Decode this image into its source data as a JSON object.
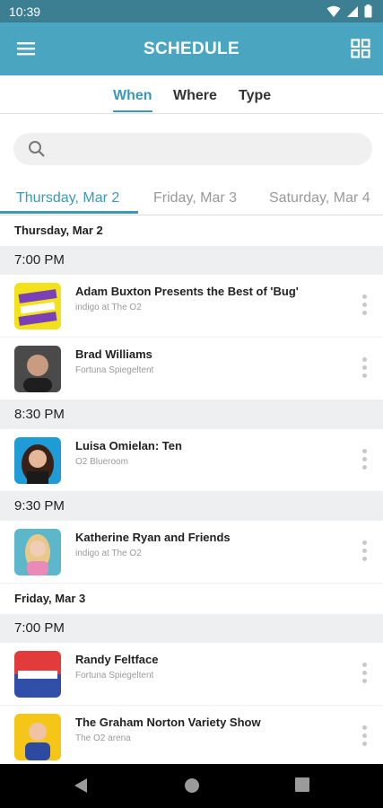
{
  "status": {
    "time": "10:39"
  },
  "appbar": {
    "title": "SCHEDULE",
    "menu_icon": "hamburger-icon",
    "grid_icon": "grid-icon"
  },
  "mode_tabs": [
    {
      "label": "When",
      "active": true
    },
    {
      "label": "Where",
      "active": false
    },
    {
      "label": "Type",
      "active": false
    }
  ],
  "search": {
    "placeholder": ""
  },
  "day_tabs": [
    {
      "label": "Thursday, Mar 2",
      "active": true
    },
    {
      "label": "Friday, Mar 3",
      "active": false
    },
    {
      "label": "Saturday, Mar 4",
      "active": false
    }
  ],
  "schedule": {
    "day1": "Thursday, Mar 2",
    "day2": "Friday, Mar 3",
    "times": [
      "7:00 PM",
      "8:30 PM",
      "9:30 PM",
      "7:00 PM"
    ],
    "events": [
      {
        "title": "Adam Buxton Presents the Best of 'Bug'",
        "venue": "indigo at The O2"
      },
      {
        "title": "Brad Williams",
        "venue": "Fortuna Spiegeltent"
      },
      {
        "title": "Luisa Omielan: Ten",
        "venue": "O2 Blueroom"
      },
      {
        "title": "Katherine Ryan and Friends",
        "venue": "indigo at The O2"
      },
      {
        "title": "Randy Feltface",
        "venue": "Fortuna Spiegeltent"
      },
      {
        "title": "The Graham Norton Variety Show",
        "venue": "The O2 arena"
      }
    ]
  },
  "colors": {
    "accent": "#3a98b8",
    "appbar": "#4aa6c0",
    "statusbar": "#3d7f92"
  }
}
